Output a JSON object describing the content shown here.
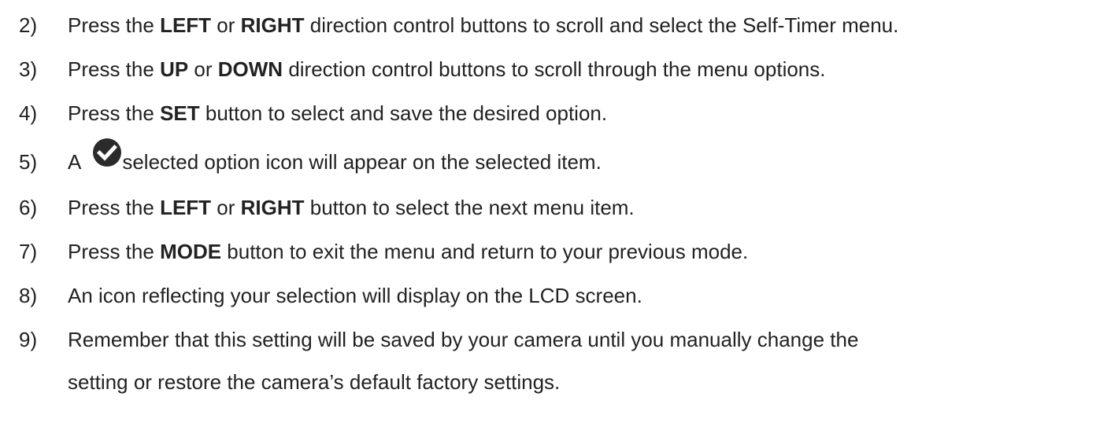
{
  "steps": [
    {
      "num": "2)",
      "parts": [
        "Press the ",
        "LEFT",
        " or ",
        "RIGHT",
        " direction control buttons to scroll and select the Self-Timer menu."
      ]
    },
    {
      "num": "3)",
      "parts": [
        "Press the ",
        "UP",
        " or ",
        "DOWN",
        " direction control buttons to scroll through the menu options."
      ]
    },
    {
      "num": "4)",
      "parts": [
        "Press the ",
        "SET",
        " button to select and save the desired option."
      ]
    },
    {
      "num": "5)",
      "before_icon": "A",
      "icon": "check-circle-icon",
      "after_icon": "selected option icon will appear on the selected item."
    },
    {
      "num": "6)",
      "parts": [
        "Press the ",
        "LEFT",
        " or ",
        "RIGHT",
        " button to select the next menu item."
      ]
    },
    {
      "num": "7)",
      "parts": [
        "Press the ",
        "MODE",
        " button to exit the menu and return to your previous mode."
      ]
    },
    {
      "num": "8)",
      "text": "An icon reflecting your selection will display on the LCD screen."
    },
    {
      "num": "9)",
      "line1": "Remember that this setting will be saved by your camera until you manually change the",
      "line2": "setting or restore the camera’s default factory settings."
    }
  ],
  "colors": {
    "text": "#222222",
    "icon": "#2b2b2b"
  }
}
